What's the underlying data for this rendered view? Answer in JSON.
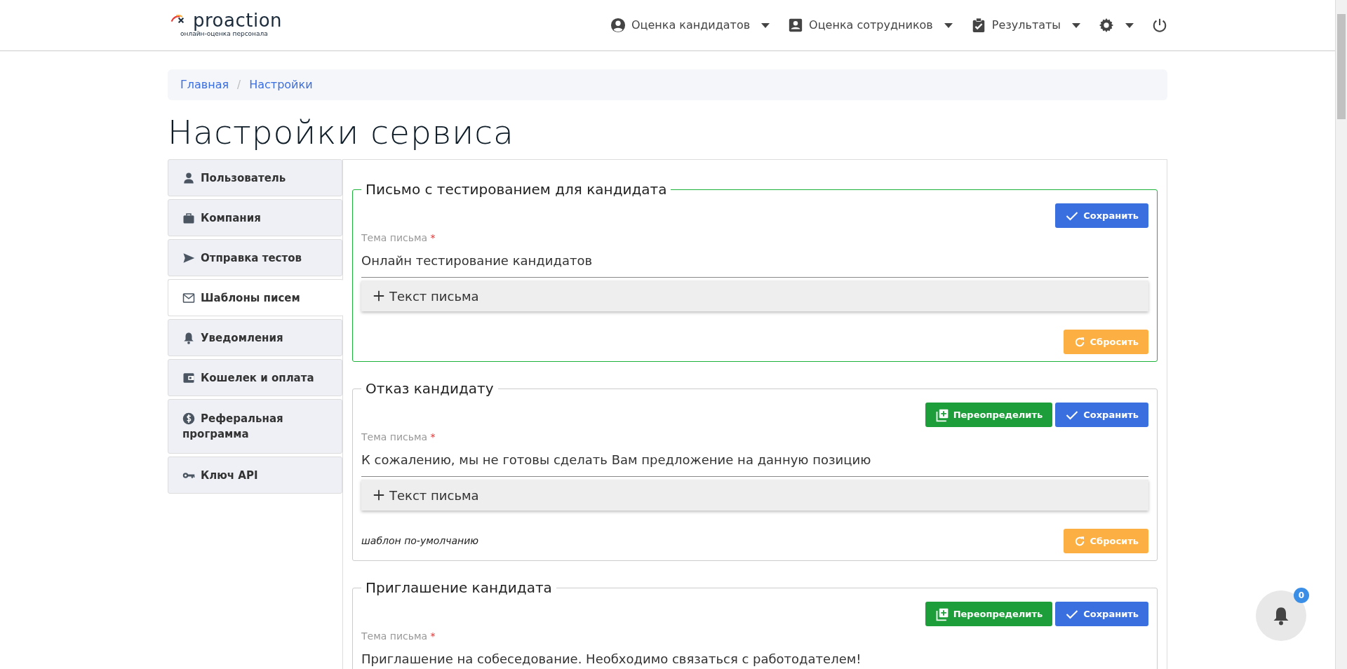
{
  "header": {
    "logo": {
      "name": "proaction",
      "tagline": "онлайн-оценка персонала"
    },
    "nav": [
      {
        "label": "Оценка кандидатов",
        "dropdown": true
      },
      {
        "label": "Оценка сотрудников",
        "dropdown": true
      },
      {
        "label": "Результаты",
        "dropdown": true
      },
      {
        "kind": "settings",
        "dropdown": true
      },
      {
        "kind": "logout",
        "dropdown": false
      }
    ]
  },
  "breadcrumb": {
    "separator": "/",
    "items": [
      {
        "label": "Главная"
      },
      {
        "label": "Настройки"
      }
    ]
  },
  "title": "Настройки сервиса",
  "sidebar": {
    "items": [
      {
        "label": "Пользователь",
        "selected": false
      },
      {
        "label": "Компания",
        "selected": false
      },
      {
        "label": "Отправка тестов",
        "selected": false
      },
      {
        "label": "Шаблоны писем",
        "selected": true
      },
      {
        "label": "Уведомления",
        "selected": false
      },
      {
        "label": "Кошелек и оплата",
        "selected": false
      },
      {
        "label": "Реферальная программа",
        "selected": false
      },
      {
        "label": "Ключ API",
        "selected": false
      }
    ]
  },
  "templates": [
    {
      "title": "Письмо с тестированием для кандидата",
      "highlighted": true,
      "buttons": [
        {
          "kind": "save",
          "label": "Сохранить"
        }
      ],
      "subject_label": "Тема письма",
      "required_mark": "*",
      "subject": "Онлайн тестирование кандидатов",
      "body_toggle": {
        "label": "Текст письма",
        "expanded": false
      },
      "reset": "Сбросить"
    },
    {
      "title": "Отказ кандидату",
      "highlighted": false,
      "buttons": [
        {
          "kind": "override",
          "label": "Переопределить"
        },
        {
          "kind": "save",
          "label": "Сохранить"
        }
      ],
      "subject_label": "Тема письма",
      "required_mark": "*",
      "subject": "К сожалению, мы не готовы сделать Вам предложение на данную позицию",
      "body_toggle": {
        "label": "Текст письма",
        "expanded": false
      },
      "note": "шаблон по-умолчанию",
      "reset": "Сбросить"
    },
    {
      "title": "Приглашение кандидата",
      "highlighted": false,
      "buttons": [
        {
          "kind": "override",
          "label": "Переопределить"
        },
        {
          "kind": "save",
          "label": "Сохранить"
        }
      ],
      "subject_label": "Тема письма",
      "required_mark": "*",
      "subject": "Приглашение на собеседование. Необходимо связаться с работодателем!"
    }
  ],
  "notifications": {
    "count": "0"
  }
}
